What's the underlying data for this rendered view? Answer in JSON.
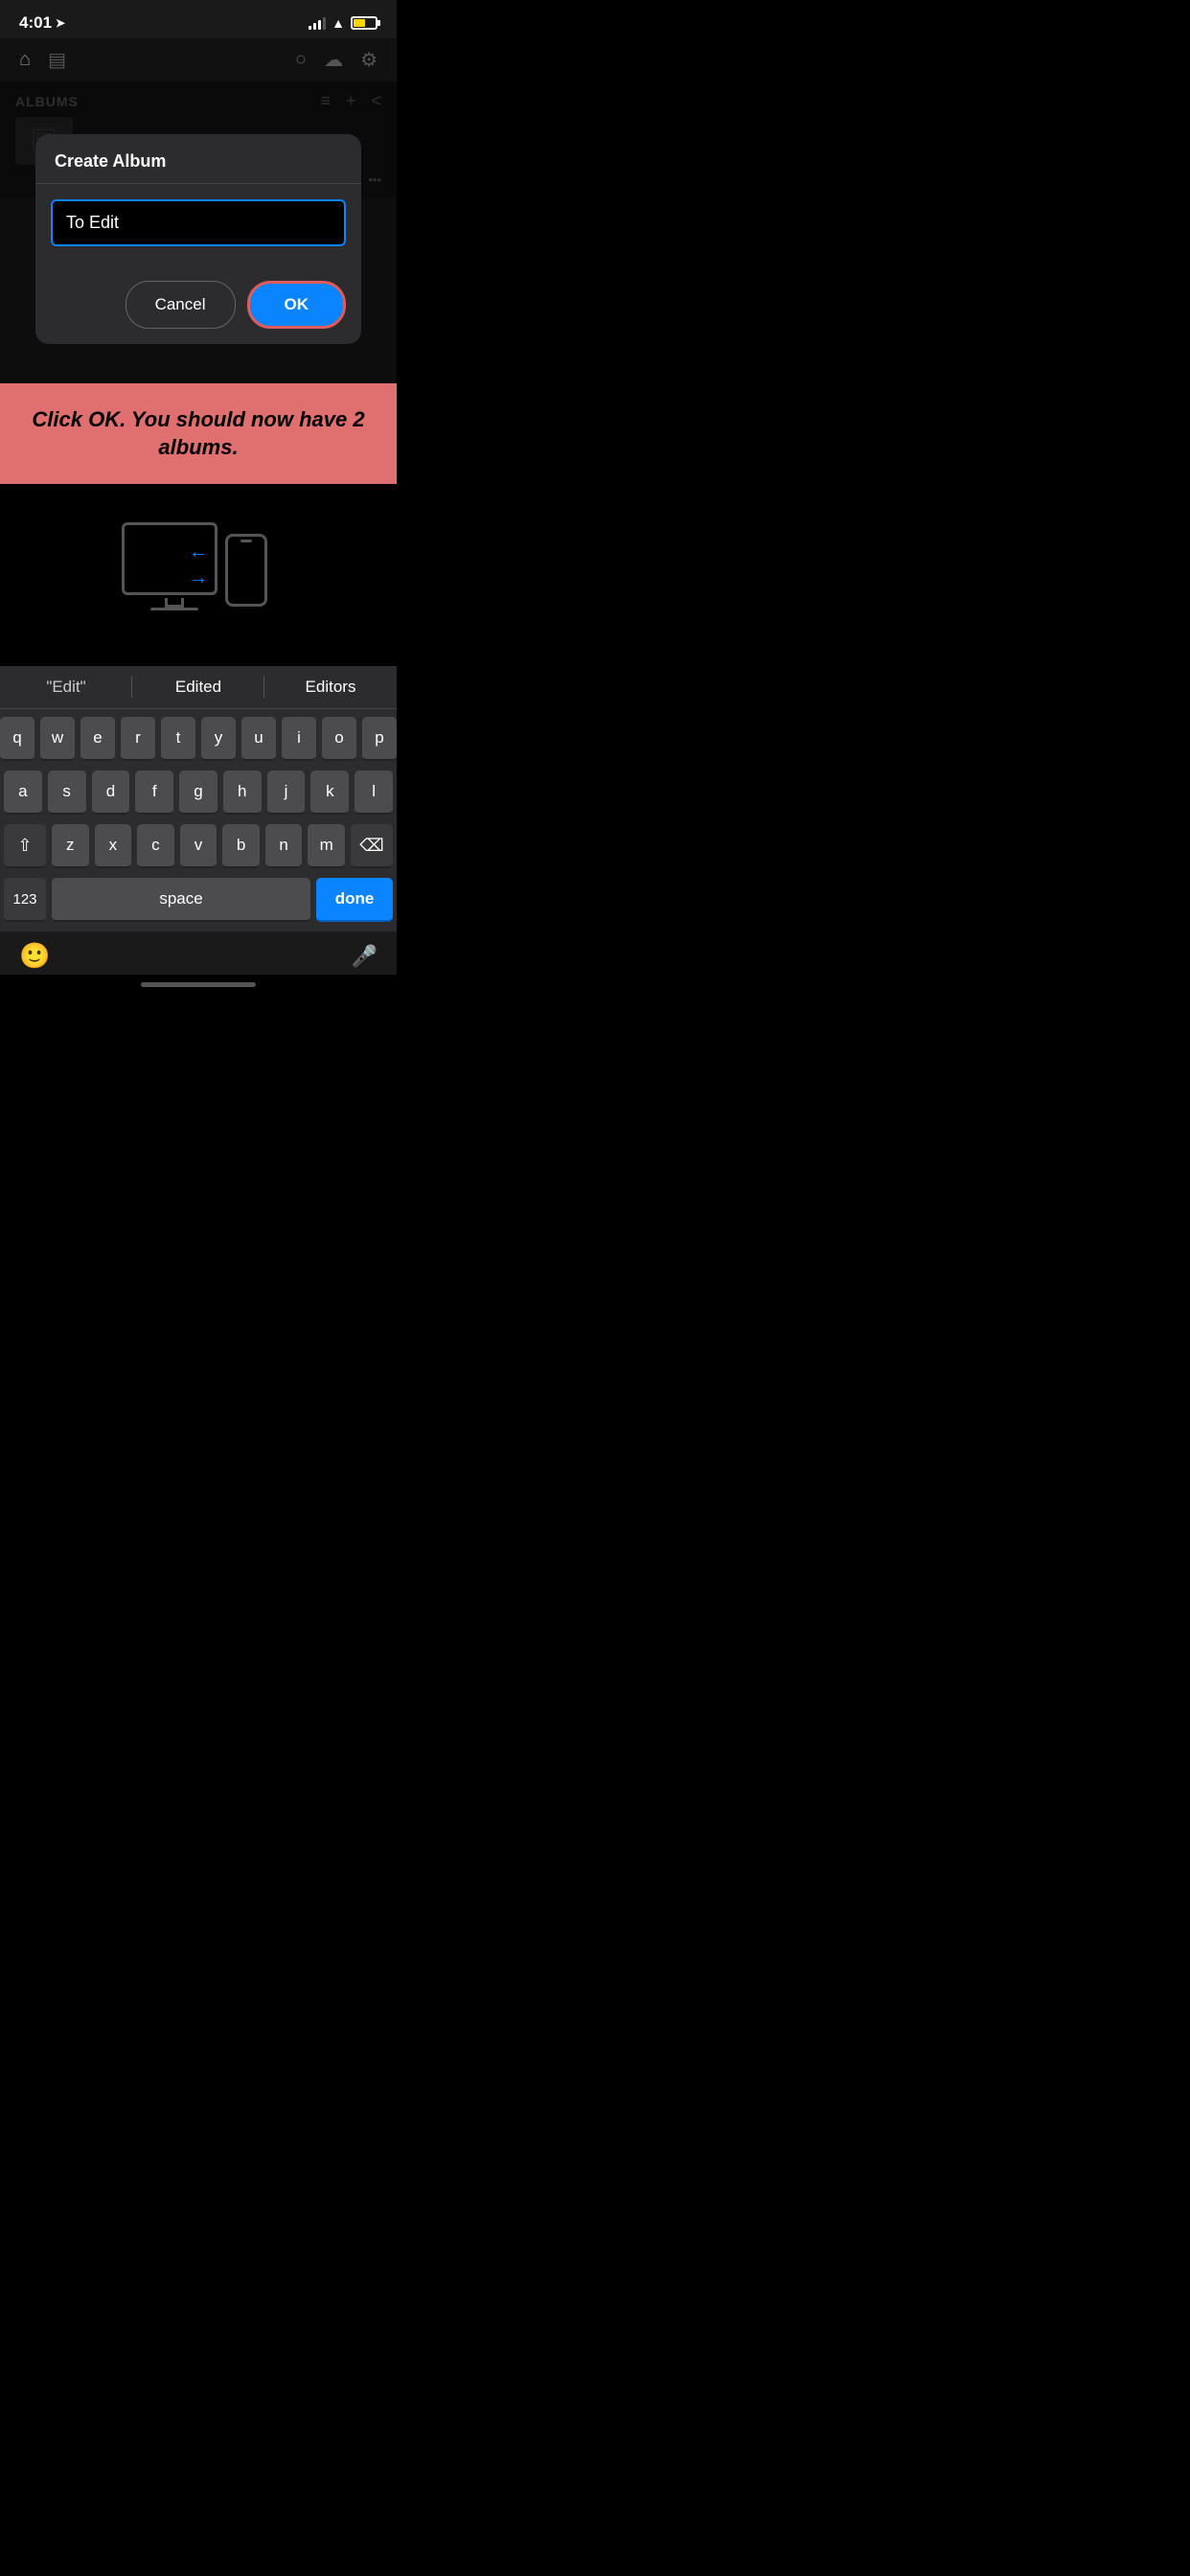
{
  "status_bar": {
    "time": "4:01",
    "location_arrow": "➤"
  },
  "app": {
    "nav": {
      "home_icon": "⌂",
      "albums_icon": "▤",
      "search_icon": "○",
      "notifications_icon": "☁",
      "settings_icon": "⚙"
    },
    "albums_label": "ALBUMS",
    "back_label": "<"
  },
  "modal": {
    "title": "Create Album",
    "input_value": "To Edit",
    "cancel_label": "Cancel",
    "ok_label": "OK"
  },
  "instruction": {
    "text": "Click OK. You should now have 2 albums."
  },
  "predictive": {
    "item1": "\"Edit\"",
    "item2": "Edited",
    "item3": "Editors"
  },
  "keyboard": {
    "row1": [
      "q",
      "w",
      "e",
      "r",
      "t",
      "y",
      "u",
      "i",
      "o",
      "p"
    ],
    "row2": [
      "a",
      "s",
      "d",
      "f",
      "g",
      "h",
      "j",
      "k",
      "l"
    ],
    "row3": [
      "z",
      "x",
      "c",
      "v",
      "b",
      "n",
      "m"
    ],
    "shift_icon": "⇧",
    "delete_icon": "⌫",
    "num_label": "123",
    "space_label": "space",
    "done_label": "done"
  }
}
